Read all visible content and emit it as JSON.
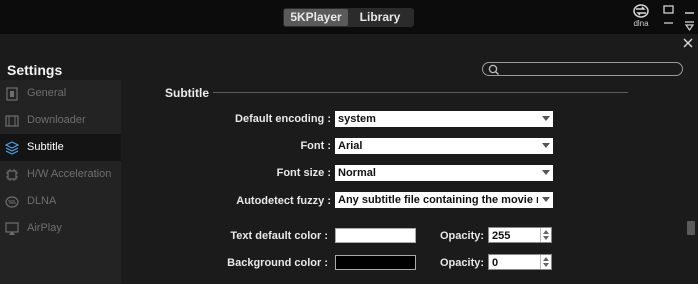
{
  "titlebar": {
    "tabs": [
      {
        "label": "5KPlayer",
        "active": true
      },
      {
        "label": "Library",
        "active": false
      }
    ],
    "dlna_label": "dlna"
  },
  "settings": {
    "title": "Settings",
    "search_placeholder": ""
  },
  "sidebar": {
    "items": [
      {
        "label": "General",
        "icon": "general-icon",
        "active": false
      },
      {
        "label": "Downloader",
        "icon": "film-icon",
        "active": false
      },
      {
        "label": "Subtitle",
        "icon": "layers-icon",
        "active": true
      },
      {
        "label": "H/W Acceleration",
        "icon": "chip-icon",
        "active": false
      },
      {
        "label": "DLNA",
        "icon": "dlna-icon",
        "active": false
      },
      {
        "label": "AirPlay",
        "icon": "airplay-icon",
        "active": false
      }
    ]
  },
  "subtitle": {
    "section_title": "Subtitle",
    "default_encoding": {
      "label": "Default encoding :",
      "value": "system"
    },
    "font": {
      "label": "Font :",
      "value": "Arial"
    },
    "font_size": {
      "label": "Font size :",
      "value": "Normal"
    },
    "autodetect": {
      "label": "Autodetect fuzzy :",
      "value": "Any subtitle file containing the movie nam"
    },
    "text_color": {
      "label": "Text default color :",
      "color": "#ffffff",
      "opacity_label": "Opacity:",
      "opacity": "255"
    },
    "bg_color": {
      "label": "Background color :",
      "color": "#000000",
      "opacity_label": "Opacity:",
      "opacity": "0"
    }
  }
}
